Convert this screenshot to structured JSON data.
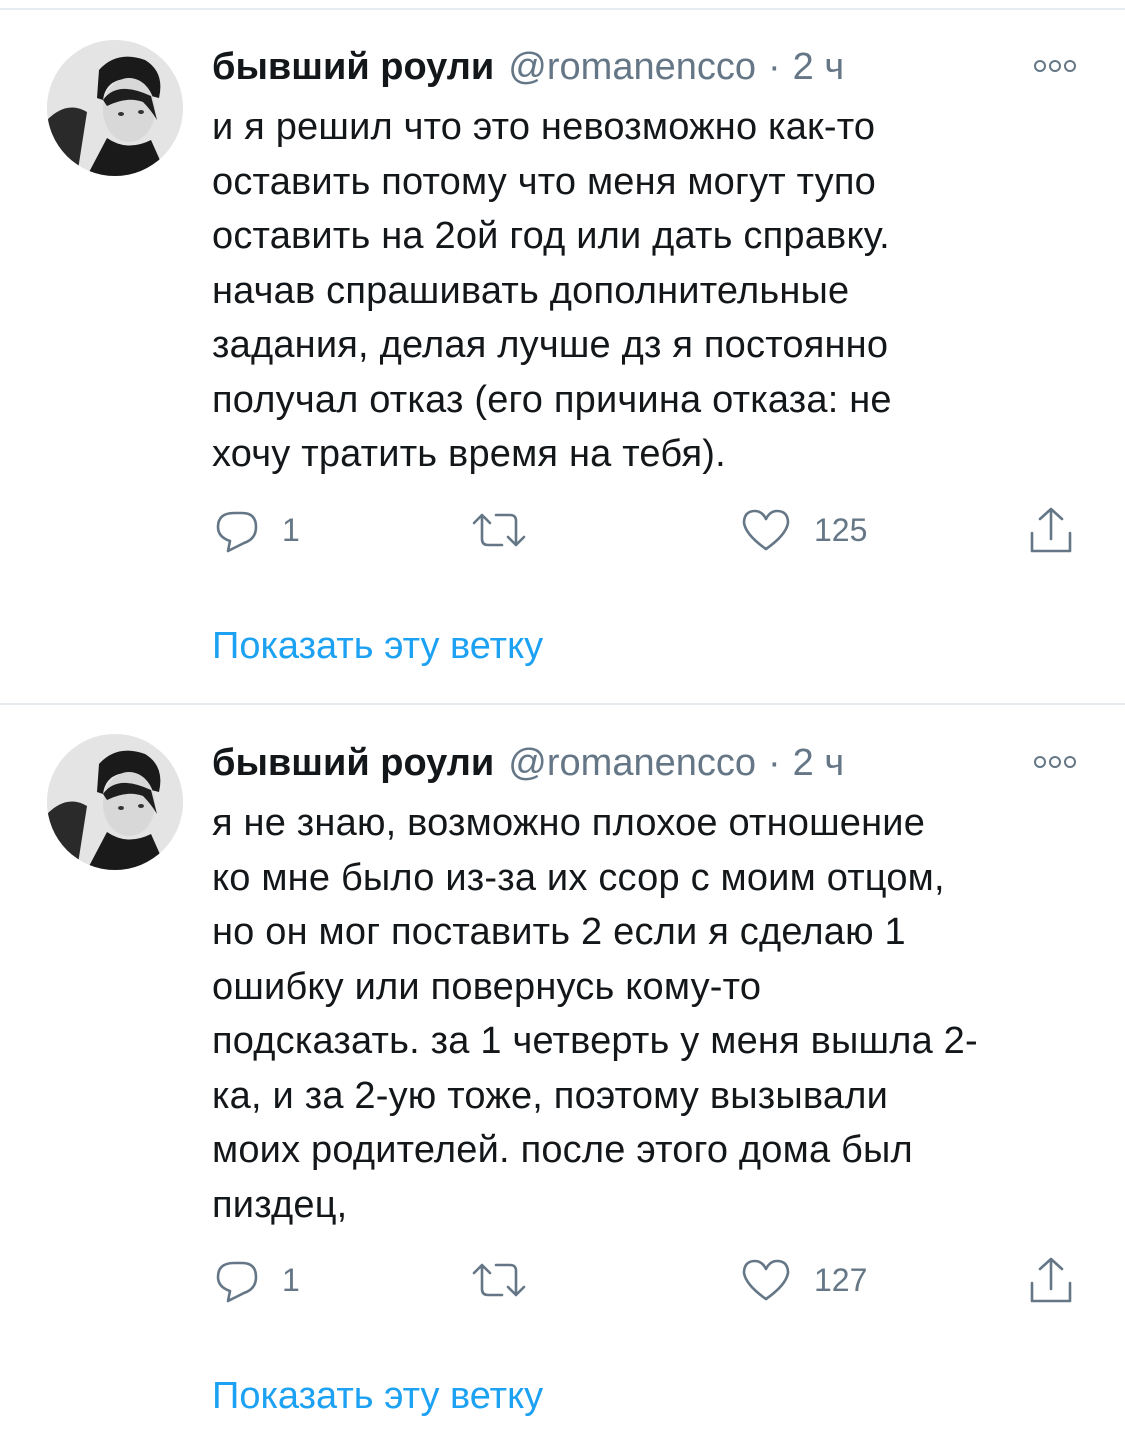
{
  "tweets": [
    {
      "display_name": "бывший роули",
      "handle": "@romanencco",
      "separator": "·",
      "time": "2 ч",
      "text_lines": [
        "и я решил что это невозможно как-то",
        "оставить потому что меня могут тупо",
        "оставить на 2ой год или дать справку.",
        "начав спрашивать дополнительные",
        "задания, делая лучше дз я постоянно",
        "получал отказ (его причина отказа: не",
        "хочу тратить время на тебя)."
      ],
      "reply_count": "1",
      "retweet_count": "",
      "like_count": "125",
      "show_thread": "Показать эту ветку"
    },
    {
      "display_name": "бывший роули",
      "handle": "@romanencco",
      "separator": "·",
      "time": "2 ч",
      "text_lines": [
        "я не знаю, возможно плохое отношение",
        "ко мне было из-за их ссор с моим отцом,",
        "но он мог поставить 2 если я сделаю 1",
        "ошибку или повернусь кому-то",
        "подсказать. за 1 четверть у меня вышла 2-",
        "ка, и за 2-ую тоже, поэтому вызывали",
        "моих родителей. после этого дома был",
        "пиздец,"
      ],
      "reply_count": "1",
      "retweet_count": "",
      "like_count": "127",
      "show_thread": "Показать эту ветку"
    }
  ],
  "icons": {
    "avatar": "avatar-photo",
    "more": "more-options-icon",
    "reply": "reply-icon",
    "retweet": "retweet-icon",
    "like": "like-icon",
    "share": "share-icon"
  },
  "colors": {
    "text": "#14171a",
    "secondary": "#657786",
    "link": "#1da1f2",
    "divider": "#e6ecf0"
  }
}
